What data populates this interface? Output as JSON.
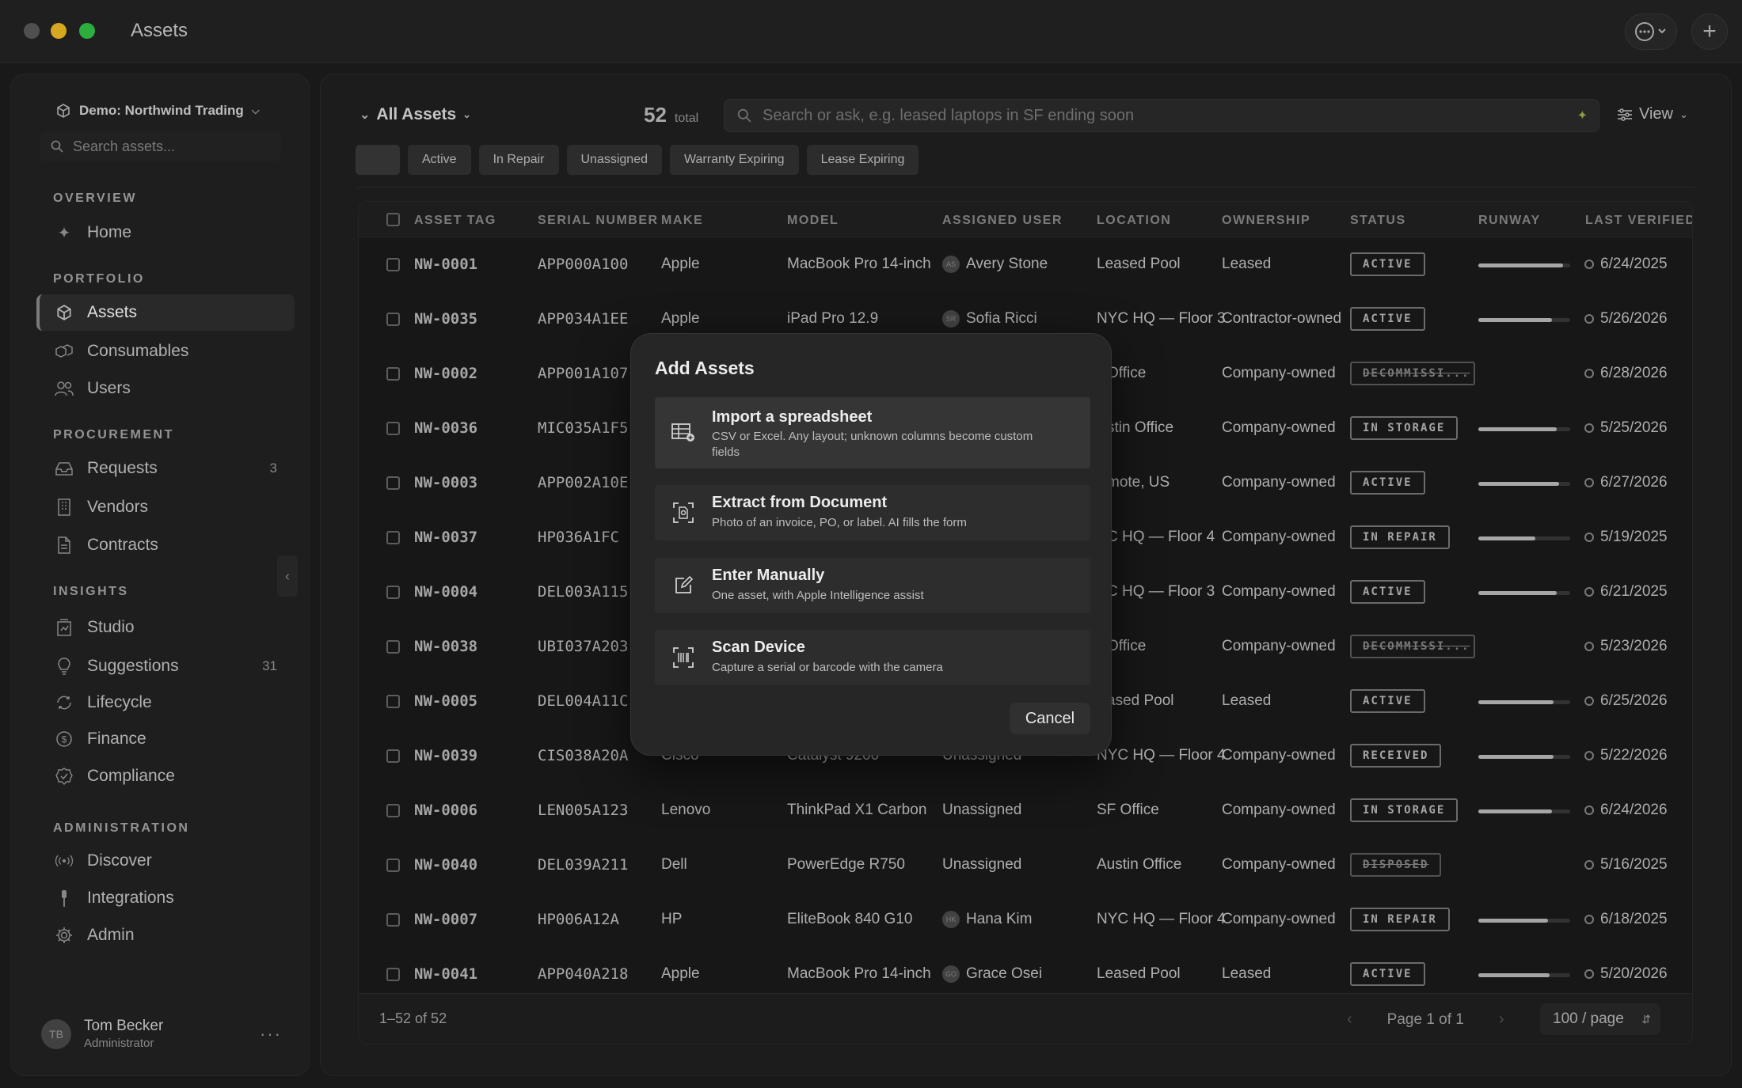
{
  "app": {
    "title": "Assets"
  },
  "sidebar": {
    "workspace": "Demo: Northwind Trading",
    "search_placeholder": "Search assets...",
    "sections": {
      "overview": "OVERVIEW",
      "portfolio": "PORTFOLIO",
      "procurement": "PROCUREMENT",
      "insights": "INSIGHTS",
      "administration": "ADMINISTRATION"
    },
    "items": {
      "home": "Home",
      "assets": "Assets",
      "consumables": "Consumables",
      "users": "Users",
      "requests": "Requests",
      "requests_count": "3",
      "vendors": "Vendors",
      "contracts": "Contracts",
      "studio": "Studio",
      "suggestions": "Suggestions",
      "suggestions_count": "31",
      "lifecycle": "Lifecycle",
      "finance": "Finance",
      "compliance": "Compliance",
      "discover": "Discover",
      "integrations": "Integrations",
      "admin": "Admin"
    },
    "user": {
      "initials": "TB",
      "name": "Tom Becker",
      "role": "Administrator"
    }
  },
  "toolbar": {
    "view_select": "All Assets",
    "total_count": "52",
    "total_label": "total",
    "search_placeholder": "Search or ask, e.g. leased laptops in SF ending soon",
    "view_button": "View"
  },
  "filters": [
    "Active",
    "In Repair",
    "Unassigned",
    "Warranty Expiring",
    "Lease Expiring"
  ],
  "table": {
    "columns": [
      "ASSET TAG",
      "SERIAL NUMBER",
      "MAKE",
      "MODEL",
      "ASSIGNED USER",
      "LOCATION",
      "OWNERSHIP",
      "STATUS",
      "RUNWAY",
      "LAST VERIFIED"
    ],
    "rows": [
      {
        "tag": "NW-0001",
        "serial": "APP000A100",
        "make": "Apple",
        "model": "MacBook Pro 14-inch",
        "user": "Avery Stone",
        "initials": "AS",
        "location": "Leased Pool",
        "ownership": "Leased",
        "status": "ACTIVE",
        "strike": false,
        "runway": 0.92,
        "verified": "6/24/2025"
      },
      {
        "tag": "NW-0035",
        "serial": "APP034A1EE",
        "make": "Apple",
        "model": "iPad Pro 12.9",
        "user": "Sofia Ricci",
        "initials": "SR",
        "location": "NYC HQ — Floor 3",
        "ownership": "Contractor-owned",
        "status": "ACTIVE",
        "strike": false,
        "runway": 0.8,
        "verified": "5/26/2026"
      },
      {
        "tag": "NW-0002",
        "serial": "APP001A107",
        "make": "",
        "model": "",
        "user": "",
        "initials": "",
        "location": "Office",
        "ownership": "Company-owned",
        "status": "DECOMMISSI...",
        "strike": true,
        "runway": null,
        "verified": "6/28/2026"
      },
      {
        "tag": "NW-0036",
        "serial": "MIC035A1F5",
        "make": "",
        "model": "",
        "user": "",
        "initials": "",
        "location": "stin Office",
        "ownership": "Company-owned",
        "status": "IN STORAGE",
        "strike": false,
        "runway": 0.85,
        "verified": "5/25/2026"
      },
      {
        "tag": "NW-0003",
        "serial": "APP002A10E",
        "make": "",
        "model": "",
        "user": "",
        "initials": "",
        "location": "mote, US",
        "ownership": "Company-owned",
        "status": "ACTIVE",
        "strike": false,
        "runway": 0.88,
        "verified": "6/27/2026"
      },
      {
        "tag": "NW-0037",
        "serial": "HP036A1FC",
        "make": "",
        "model": "",
        "user": "",
        "initials": "",
        "location": "C HQ — Floor 4",
        "ownership": "Company-owned",
        "status": "IN REPAIR",
        "strike": false,
        "runway": 0.62,
        "verified": "5/19/2025"
      },
      {
        "tag": "NW-0004",
        "serial": "DEL003A115",
        "make": "",
        "model": "",
        "user": "",
        "initials": "",
        "location": "C HQ — Floor 3",
        "ownership": "Company-owned",
        "status": "ACTIVE",
        "strike": false,
        "runway": 0.85,
        "verified": "6/21/2025"
      },
      {
        "tag": "NW-0038",
        "serial": "UBI037A203",
        "make": "",
        "model": "",
        "user": "",
        "initials": "",
        "location": "Office",
        "ownership": "Company-owned",
        "status": "DECOMMISSI...",
        "strike": true,
        "runway": null,
        "verified": "5/23/2026"
      },
      {
        "tag": "NW-0005",
        "serial": "DEL004A11C",
        "make": "",
        "model": "",
        "user": "",
        "initials": "",
        "location": "ased Pool",
        "ownership": "Leased",
        "status": "ACTIVE",
        "strike": false,
        "runway": 0.82,
        "verified": "6/25/2026"
      },
      {
        "tag": "NW-0039",
        "serial": "CIS038A20A",
        "make": "Cisco",
        "model": "Catalyst 9200",
        "user": "Unassigned",
        "initials": "",
        "location": "NYC HQ — Floor 4",
        "ownership": "Company-owned",
        "status": "RECEIVED",
        "strike": false,
        "runway": 0.82,
        "verified": "5/22/2026"
      },
      {
        "tag": "NW-0006",
        "serial": "LEN005A123",
        "make": "Lenovo",
        "model": "ThinkPad X1 Carbon",
        "user": "Unassigned",
        "initials": "",
        "location": "SF Office",
        "ownership": "Company-owned",
        "status": "IN STORAGE",
        "strike": false,
        "runway": 0.8,
        "verified": "6/24/2026"
      },
      {
        "tag": "NW-0040",
        "serial": "DEL039A211",
        "make": "Dell",
        "model": "PowerEdge R750",
        "user": "Unassigned",
        "initials": "",
        "location": "Austin Office",
        "ownership": "Company-owned",
        "status": "DISPOSED",
        "strike": true,
        "runway": null,
        "verified": "5/16/2025"
      },
      {
        "tag": "NW-0007",
        "serial": "HP006A12A",
        "make": "HP",
        "model": "EliteBook 840 G10",
        "user": "Hana Kim",
        "initials": "HK",
        "location": "NYC HQ — Floor 4",
        "ownership": "Company-owned",
        "status": "IN REPAIR",
        "strike": false,
        "runway": 0.76,
        "verified": "6/18/2025"
      },
      {
        "tag": "NW-0041",
        "serial": "APP040A218",
        "make": "Apple",
        "model": "MacBook Pro 14-inch",
        "user": "Grace Osei",
        "initials": "GO",
        "location": "Leased Pool",
        "ownership": "Leased",
        "status": "ACTIVE",
        "strike": false,
        "runway": 0.78,
        "verified": "5/20/2026"
      }
    ],
    "footer_range": "1–52 of 52",
    "page_label": "Page 1 of 1",
    "per_page": "100 / page"
  },
  "modal": {
    "title": "Add Assets",
    "options": [
      {
        "title": "Import a spreadsheet",
        "desc": "CSV or Excel. Any layout; unknown columns become custom fields"
      },
      {
        "title": "Extract from Document",
        "desc": "Photo of an invoice, PO, or label. AI fills the form"
      },
      {
        "title": "Enter Manually",
        "desc": "One asset, with Apple Intelligence assist"
      },
      {
        "title": "Scan Device",
        "desc": "Capture a serial or barcode with the camera"
      }
    ],
    "cancel_label": "Cancel"
  }
}
